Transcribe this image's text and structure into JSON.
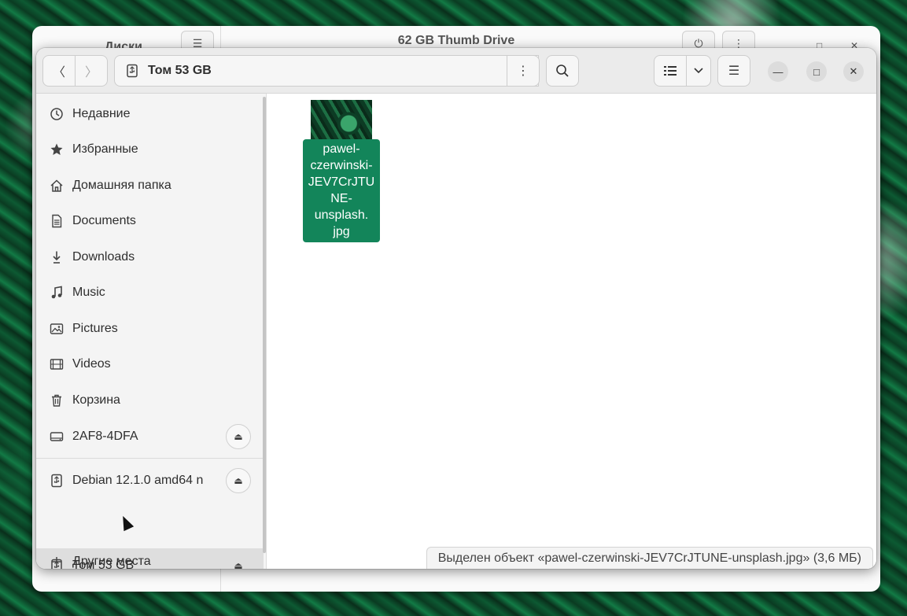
{
  "background_window": {
    "title": "62 GB Thumb Drive",
    "side_title": "Диски"
  },
  "header": {
    "path": "Том 53 GB"
  },
  "sidebar": {
    "items": [
      {
        "label": "Недавние",
        "icon": "clock-icon"
      },
      {
        "label": "Избранные",
        "icon": "star-icon"
      },
      {
        "label": "Домашняя папка",
        "icon": "home-icon"
      },
      {
        "label": "Documents",
        "icon": "document-icon"
      },
      {
        "label": "Downloads",
        "icon": "download-icon"
      },
      {
        "label": "Music",
        "icon": "music-icon"
      },
      {
        "label": "Pictures",
        "icon": "picture-icon"
      },
      {
        "label": "Videos",
        "icon": "video-icon"
      },
      {
        "label": "Корзина",
        "icon": "trash-icon"
      },
      {
        "label": "2AF8-4DFA",
        "icon": "drive-icon"
      },
      {
        "label": "Debian 12.1.0 amd64 n",
        "icon": "usb-icon"
      },
      {
        "label": "Том 53 GB",
        "icon": "usb-icon"
      },
      {
        "label": "Другие места",
        "icon": "plus-icon"
      }
    ]
  },
  "files": [
    {
      "name": "pawel-czerwinski-JEV7CrJTUNE-unsplash.jpg",
      "label_lines": [
        "pawel-",
        "czerwinski-",
        "JEV7CrJTU",
        "NE-",
        "unsplash.",
        "jpg"
      ]
    }
  ],
  "status": {
    "text": "Выделен объект «pawel-czerwinski-JEV7CrJTUNE-unsplash.jpg» (3,6 МБ)"
  },
  "colors": {
    "selection": "#13855a",
    "headerbar": "#ebebeb",
    "sidebar": "#f4f4f4"
  }
}
